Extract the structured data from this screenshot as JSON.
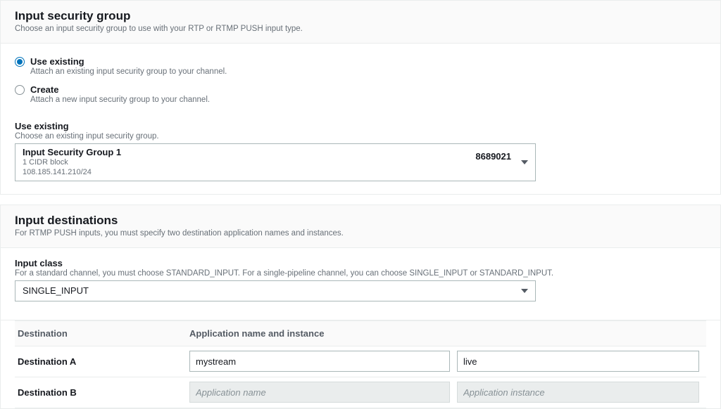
{
  "security_group": {
    "title": "Input security group",
    "description": "Choose an input security group to use with your RTP or RTMP PUSH input type.",
    "options": {
      "use_existing": {
        "label": "Use existing",
        "hint": "Attach an existing input security group to your channel."
      },
      "create": {
        "label": "Create",
        "hint": "Attach a new input security group to your channel."
      }
    },
    "use_existing_field": {
      "label": "Use existing",
      "hint": "Choose an existing input security group.",
      "selected": {
        "name": "Input Security Group 1",
        "cidr_summary": "1 CIDR block",
        "cidr_value": "108.185.141.210/24",
        "id": "8689021"
      }
    }
  },
  "destinations": {
    "title": "Input destinations",
    "description": "For RTMP PUSH inputs, you must specify two destination application names and instances.",
    "input_class": {
      "label": "Input class",
      "hint": "For a standard channel, you must choose STANDARD_INPUT. For a single-pipeline channel, you can choose SINGLE_INPUT or STANDARD_INPUT.",
      "value": "SINGLE_INPUT"
    },
    "table": {
      "col_destination": "Destination",
      "col_app_instance": "Application name and instance",
      "placeholder_app": "Application name",
      "placeholder_inst": "Application instance",
      "rows": [
        {
          "label": "Destination A",
          "app": "mystream",
          "instance": "live",
          "enabled": true
        },
        {
          "label": "Destination B",
          "app": "",
          "instance": "",
          "enabled": false
        }
      ]
    }
  }
}
